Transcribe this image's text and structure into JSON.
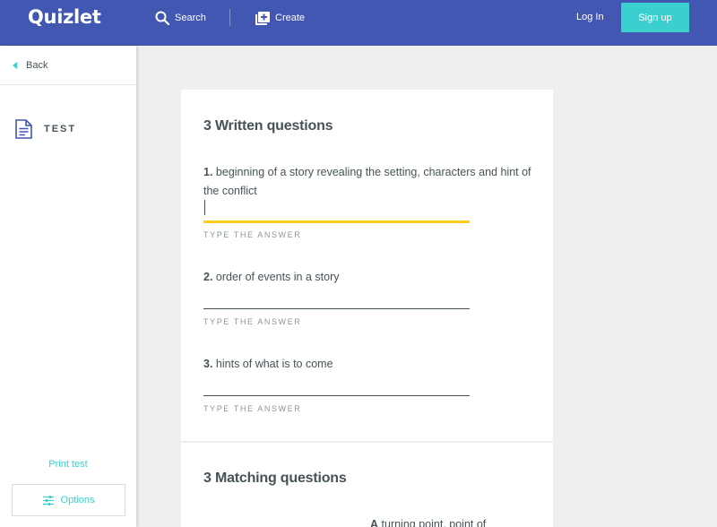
{
  "header": {
    "logo": "Quizlet",
    "search_label": "Search",
    "create_label": "Create",
    "login_label": "Log In",
    "signup_label": "Sign up",
    "colors": {
      "bar": "#4257b2",
      "signup": "#3ccfcf"
    }
  },
  "sidebar": {
    "back_label": "Back",
    "mode_label": "TEST",
    "print_label": "Print test",
    "options_label": "Options"
  },
  "written": {
    "title": "3 Written questions",
    "questions": [
      {
        "number": "1.",
        "text": "beginning of a story revealing the setting, characters and hint of the conflict",
        "hint": "TYPE THE ANSWER"
      },
      {
        "number": "2.",
        "text": "order of events in a story",
        "hint": "TYPE THE ANSWER"
      },
      {
        "number": "3.",
        "text": "hints of what is to come",
        "hint": "TYPE THE ANSWER"
      }
    ]
  },
  "matching": {
    "title": "3 Matching questions",
    "first_option_letter": "A",
    "first_option_text": "turning point, point of"
  },
  "icons": {
    "search": "search-icon",
    "create": "create-plus-icon",
    "back": "back-arrow-icon",
    "test": "test-document-icon",
    "options": "options-sliders-icon"
  }
}
